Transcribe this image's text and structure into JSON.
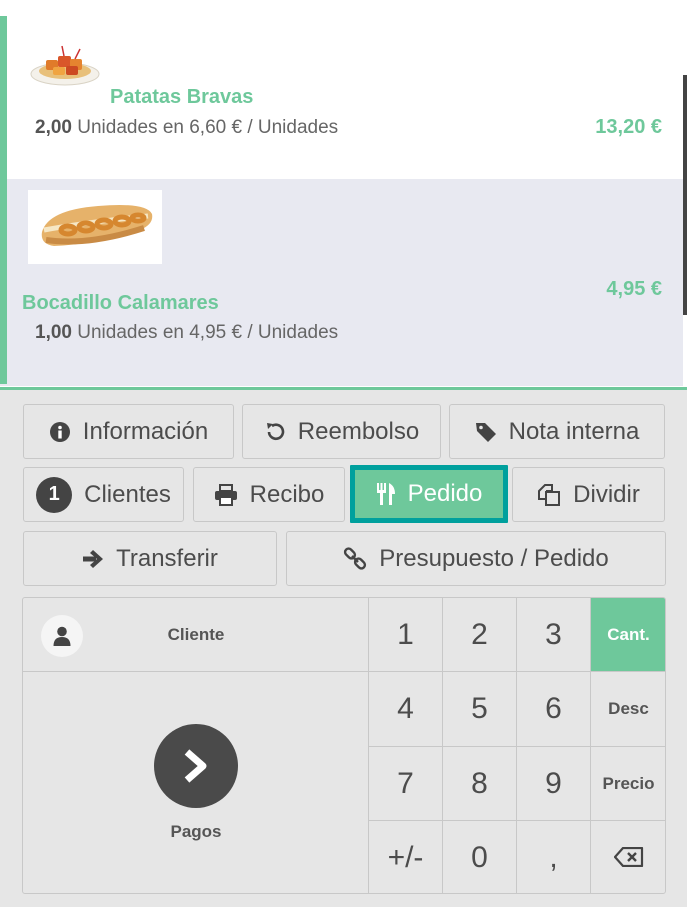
{
  "orderlines": [
    {
      "name": "Patatas Bravas",
      "qty": "2,00",
      "unit_info": "Unidades en 6,60 € / Unidades",
      "price": "13,20 €",
      "image": "patatas-bravas-image"
    },
    {
      "name": "Bocadillo Calamares",
      "qty": "1,00",
      "unit_info": "Unidades en 4,95 € / Unidades",
      "price": "4,95 €",
      "image": "bocadillo-image"
    }
  ],
  "controls": {
    "info": "Información",
    "refund": "Reembolso",
    "internal_note": "Nota interna",
    "guests_count": "1",
    "guests": "Clientes",
    "receipt": "Recibo",
    "order": "Pedido",
    "split": "Dividir",
    "transfer": "Transferir",
    "quotation": "Presupuesto / Pedido"
  },
  "pad": {
    "customer": "Cliente",
    "payment": "Pagos",
    "keys": [
      "1",
      "2",
      "3",
      "4",
      "5",
      "6",
      "7",
      "8",
      "9",
      "+/-",
      "0",
      ","
    ],
    "modes": {
      "qty": "Cant.",
      "disc": "Desc",
      "price": "Precio"
    }
  },
  "colors": {
    "accent": "#6ec89b",
    "active_border": "#00a09d",
    "dark": "#4a4a4a"
  },
  "icons": {
    "info": "info-circle-icon",
    "refund": "undo-icon",
    "note": "tag-icon",
    "receipt": "print-icon",
    "order": "cutlery-icon",
    "split": "copy-icon",
    "transfer": "arrow-right-icon",
    "quotation": "link-icon",
    "customer": "user-icon",
    "payment": "chevron-right-icon",
    "backspace": "backspace-icon"
  }
}
